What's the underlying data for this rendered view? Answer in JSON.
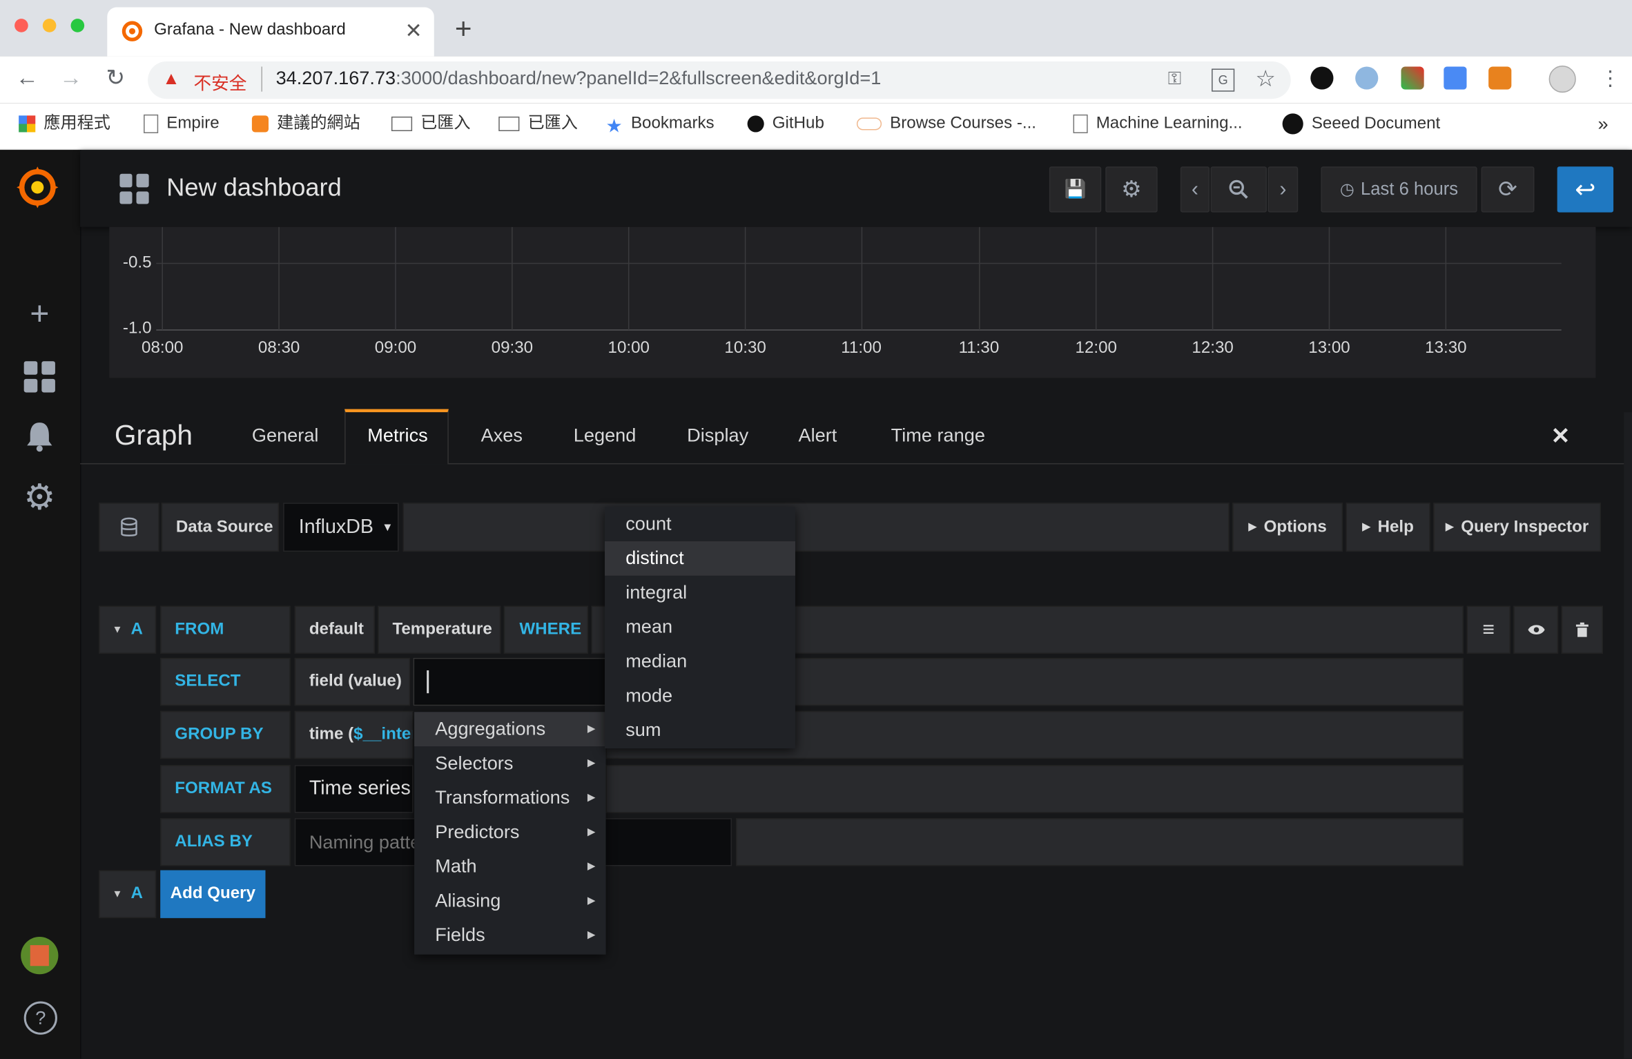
{
  "ui_scale": 1.5078,
  "browser": {
    "tab_title": "Grafana - New dashboard",
    "new_tab": "+",
    "security_label": "不安全",
    "url_host": "34.207.167.73",
    "url_rest": ":3000/dashboard/new?panelId=2&fullscreen&edit&orgId=1",
    "bookmarks": [
      "應用程式",
      "Empire",
      "建議的網站",
      "已匯入",
      "已匯入",
      "Bookmarks",
      "GitHub",
      "Browse Courses -...",
      "Machine Learning...",
      "Seeed Document"
    ],
    "more": "»"
  },
  "header": {
    "title": "New dashboard",
    "time_range": "Last 6 hours"
  },
  "graph": {
    "y_labels": [
      "-0.5",
      "-1.0"
    ],
    "x_labels": [
      "08:00",
      "08:30",
      "09:00",
      "09:30",
      "10:00",
      "10:30",
      "11:00",
      "11:30",
      "12:00",
      "12:30",
      "13:00",
      "13:30"
    ]
  },
  "editor": {
    "title": "Graph",
    "tabs": [
      "General",
      "Metrics",
      "Axes",
      "Legend",
      "Display",
      "Alert",
      "Time range"
    ],
    "active_tab": "Metrics",
    "close": "✕",
    "datasource_label": "Data Source",
    "datasource_value": "InfluxDB",
    "options": "Options",
    "help": "Help",
    "query_inspector": "Query Inspector"
  },
  "query": {
    "ref": "A",
    "from_label": "FROM",
    "from_policy": "default",
    "from_measurement": "Temperature",
    "where_label": "WHERE",
    "select_label": "SELECT",
    "select_field": "field (value)",
    "group_label": "GROUP BY",
    "group_time": "time (",
    "group_interval": "$__interval",
    "format_label": "FORMAT AS",
    "format_value": "Time series",
    "alias_label": "ALIAS BY",
    "alias_placeholder": "Naming pattern",
    "add_query": "Add Query"
  },
  "menu": {
    "items": [
      "Aggregations",
      "Selectors",
      "Transformations",
      "Predictors",
      "Math",
      "Aliasing",
      "Fields"
    ],
    "selected": "Aggregations"
  },
  "submenu": {
    "items": [
      "count",
      "distinct",
      "integral",
      "mean",
      "median",
      "mode",
      "sum"
    ],
    "highlighted": "distinct"
  },
  "colors": {
    "accent": "#33b5e5",
    "primary_button": "#1f78c1",
    "tab_active_border": "#f79520"
  }
}
